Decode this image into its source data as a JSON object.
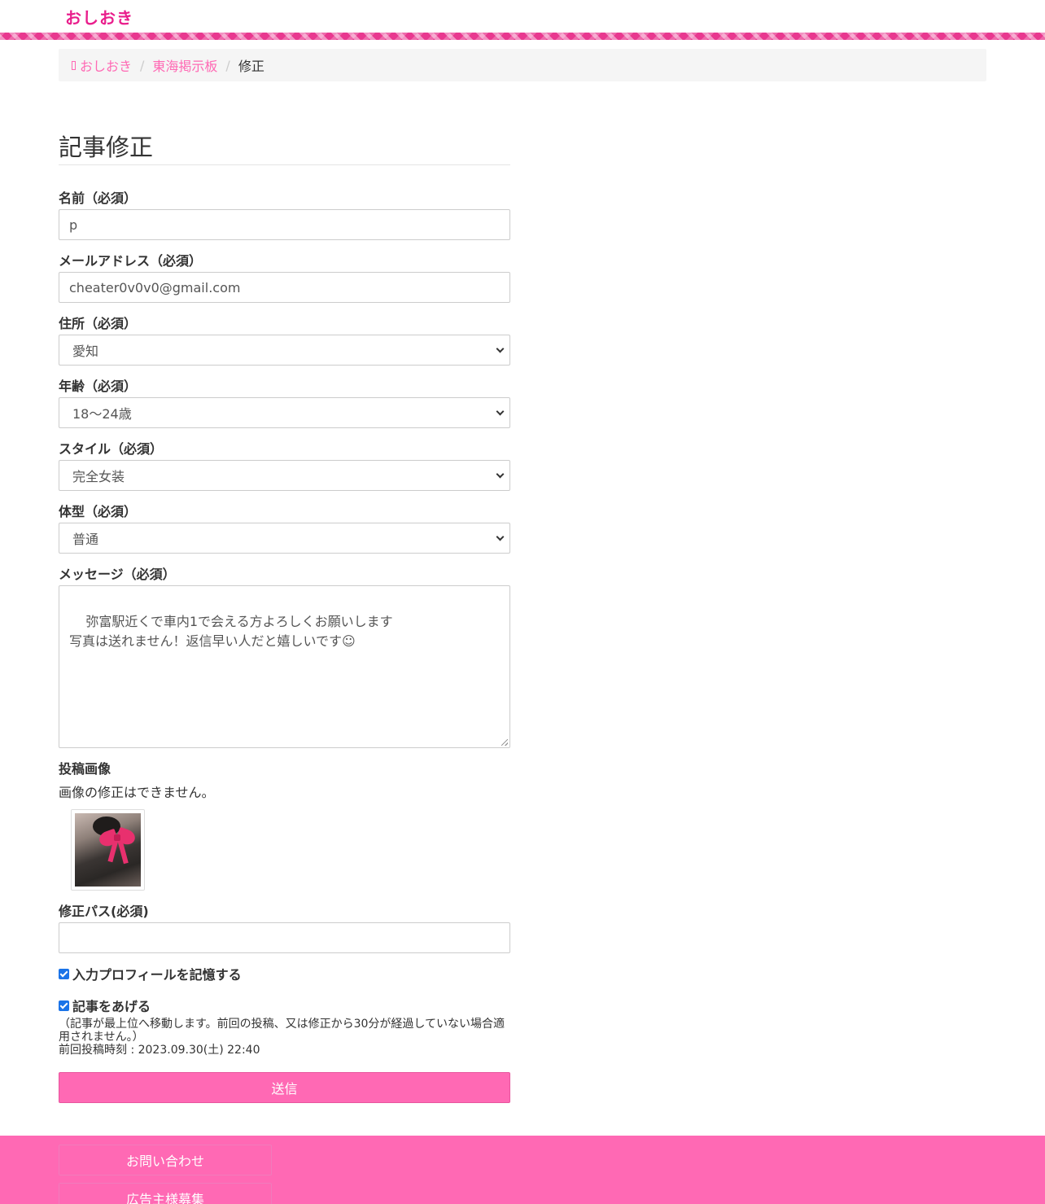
{
  "header": {
    "logo": "おしおき"
  },
  "breadcrumb": {
    "home": "おしおき",
    "board": "東海掲示板",
    "current": "修正"
  },
  "form": {
    "title": "記事修正",
    "name_label": "名前（必須）",
    "name_value": "p",
    "email_label": "メールアドレス（必須）",
    "email_value": "cheater0v0v0@gmail.com",
    "address_label": "住所（必須）",
    "address_value": "愛知",
    "age_label": "年齢（必須）",
    "age_value": "18〜24歳",
    "style_label": "スタイル（必須）",
    "style_value": "完全女装",
    "body_label": "体型（必須）",
    "body_value": "普通",
    "message_label": "メッセージ（必須）",
    "message_value": "弥富駅近くで車内1で会える方よろしくお願いします\n写真は送れません！返信早い人だと嬉しいです☺",
    "image_label": "投稿画像",
    "image_note": "画像の修正はできません。",
    "pass_label": "修正パス(必須)",
    "pass_value": "",
    "remember_label": "入力プロフィールを記憶する",
    "remember_checked": true,
    "bump_label": "記事をあげる",
    "bump_checked": true,
    "bump_note": "（記事が最上位へ移動します。前回の投稿、又は修正から30分が経過していない場合適用されません。）",
    "last_post": "前回投稿時刻 : 2023.09.30(土) 22:40",
    "submit_label": "送信"
  },
  "footer": {
    "contact": "お問い合わせ",
    "advertisers": "広告主様募集"
  },
  "colors": {
    "accent": "#ff69b4",
    "logo": "#e91e8c"
  }
}
